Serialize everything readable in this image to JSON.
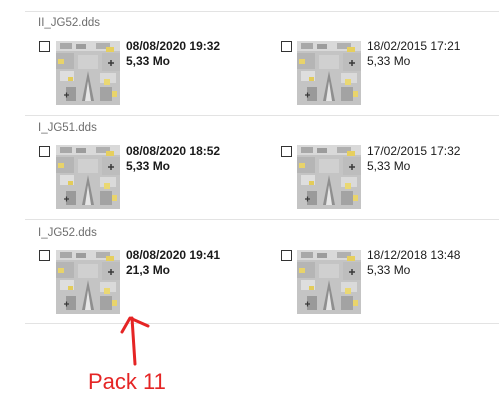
{
  "groups": [
    {
      "title": "II_JG52.dds",
      "items": [
        {
          "date": "08/08/2020 19:32",
          "size": "5,33 Mo",
          "bold": true
        },
        {
          "date": "18/02/2015 17:21",
          "size": "5,33 Mo",
          "bold": false
        }
      ]
    },
    {
      "title": "I_JG51.dds",
      "items": [
        {
          "date": "08/08/2020 18:52",
          "size": "5,33 Mo",
          "bold": true
        },
        {
          "date": "17/02/2015 17:32",
          "size": "5,33 Mo",
          "bold": false
        }
      ]
    },
    {
      "title": "I_JG52.dds",
      "items": [
        {
          "date": "08/08/2020 19:41",
          "size": "21,3 Mo",
          "bold": true
        },
        {
          "date": "18/12/2018 13:48",
          "size": "5,33 Mo",
          "bold": false
        }
      ]
    }
  ],
  "annotation": {
    "text": "Pack 11",
    "color": "#e52424"
  },
  "icons": {
    "thumbnail": "texture-thumbnail",
    "checkbox": "checkbox-unchecked"
  }
}
